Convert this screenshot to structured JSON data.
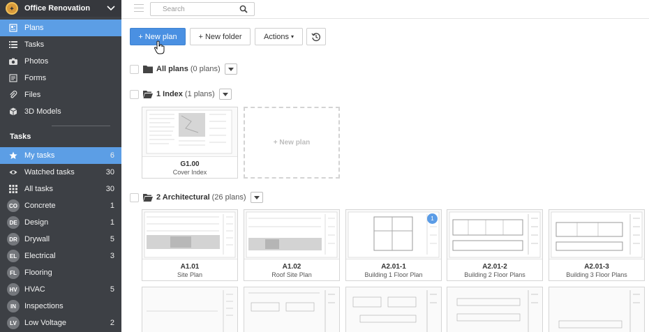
{
  "project": {
    "name": "Office Renovation"
  },
  "nav": [
    {
      "label": "Plans",
      "icon": "plans-icon",
      "active": true
    },
    {
      "label": "Tasks",
      "icon": "list-icon"
    },
    {
      "label": "Photos",
      "icon": "camera-icon"
    },
    {
      "label": "Forms",
      "icon": "forms-icon"
    },
    {
      "label": "Files",
      "icon": "paperclip-icon"
    },
    {
      "label": "3D Models",
      "icon": "cube-icon"
    }
  ],
  "tasks_section": {
    "title": "Tasks",
    "items": [
      {
        "label": "My tasks",
        "count": "6",
        "icon": "star-icon",
        "active": true
      },
      {
        "label": "Watched tasks",
        "count": "30",
        "icon": "eye-icon"
      },
      {
        "label": "All tasks",
        "count": "30",
        "icon": "grid-icon"
      },
      {
        "label": "Concrete",
        "count": "1",
        "badge": "CO"
      },
      {
        "label": "Design",
        "count": "1",
        "badge": "DE"
      },
      {
        "label": "Drywall",
        "count": "5",
        "badge": "DR"
      },
      {
        "label": "Electrical",
        "count": "3",
        "badge": "EL"
      },
      {
        "label": "Flooring",
        "count": "",
        "badge": "FL"
      },
      {
        "label": "HVAC",
        "count": "5",
        "badge": "HV"
      },
      {
        "label": "Inspections",
        "count": "",
        "badge": "IN"
      },
      {
        "label": "Low Voltage",
        "count": "2",
        "badge": "LV"
      }
    ]
  },
  "search": {
    "placeholder": "Search"
  },
  "toolbar": {
    "new_plan": "+ New plan",
    "new_folder": "+ New folder",
    "actions": "Actions",
    "actions_caret": "▾"
  },
  "folders": {
    "all": {
      "title": "All plans",
      "count": "(0 plans)"
    },
    "index": {
      "title": "1 Index",
      "count": "(1 plans)"
    },
    "arch": {
      "title": "2 Architectural",
      "count": "(26 plans)"
    }
  },
  "index_plans": [
    {
      "code": "G1.00",
      "title": "Cover Index"
    }
  ],
  "new_plan_card": "+ New plan",
  "arch_plans": [
    {
      "code": "A1.01",
      "title": "Site Plan"
    },
    {
      "code": "A1.02",
      "title": "Roof Site Plan"
    },
    {
      "code": "A2.01-1",
      "title": "Building 1 Floor Plan",
      "badge": "1"
    },
    {
      "code": "A2.01-2",
      "title": "Building 2 Floor Plans"
    },
    {
      "code": "A2.01-3",
      "title": "Building 3 Floor Plans"
    }
  ],
  "colors": {
    "sidebar_bg": "#3d4045",
    "accent": "#5c9ee5",
    "primary_button": "#4a90e2"
  }
}
